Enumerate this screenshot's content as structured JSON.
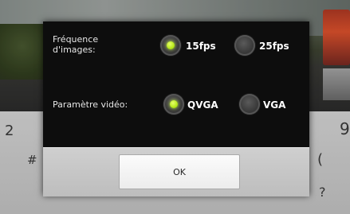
{
  "dialog": {
    "frame_rate": {
      "label": "Fréquence d'images:",
      "options": [
        {
          "label": "15fps",
          "selected": true
        },
        {
          "label": "25fps",
          "selected": false
        }
      ]
    },
    "video_param": {
      "label": "Paramètre vidéo:",
      "options": [
        {
          "label": "QVGA",
          "selected": true
        },
        {
          "label": "VGA",
          "selected": false
        }
      ]
    },
    "ok_label": "OK"
  },
  "keyboard_keys": [
    "2",
    "9",
    "#",
    "(",
    "?"
  ],
  "colors": {
    "dialog_bg": "#0d0d0d",
    "radio_selected": "#b6e81a",
    "button_bar": "#c6c6c6"
  }
}
